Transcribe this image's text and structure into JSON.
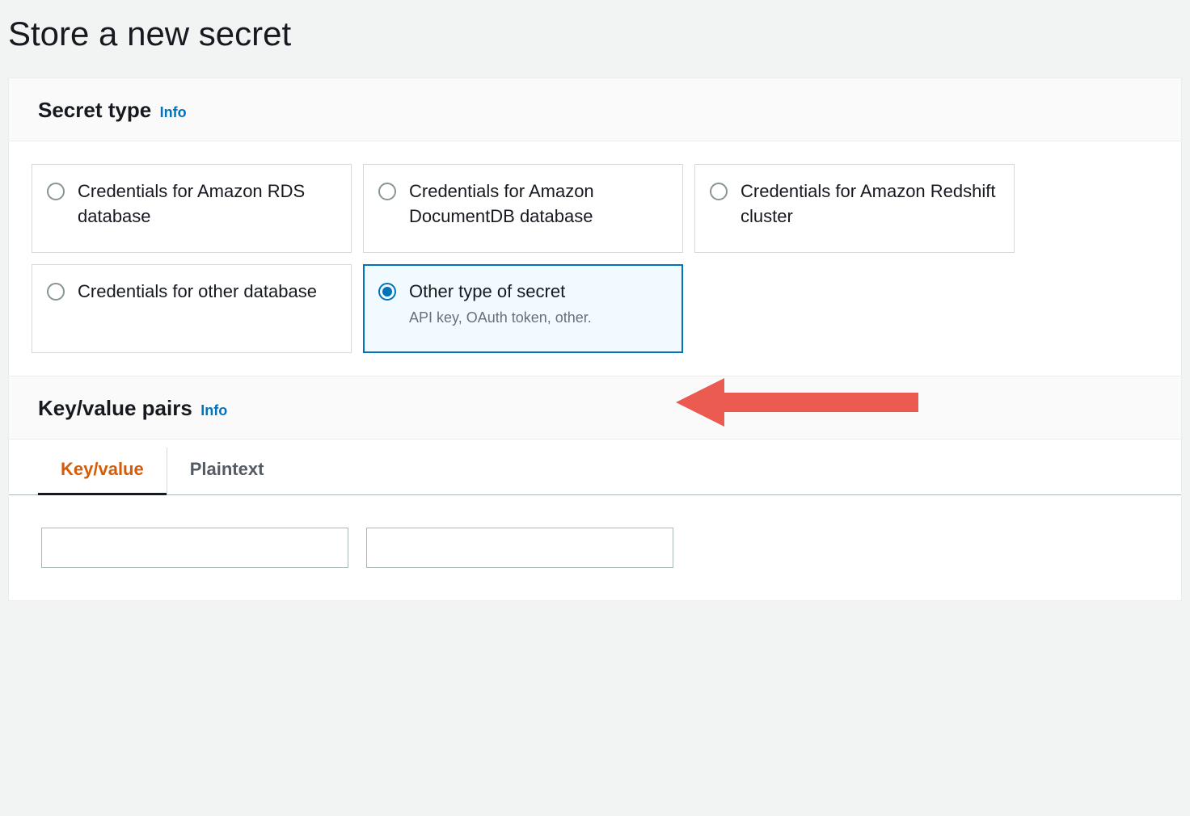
{
  "page": {
    "title": "Store a new secret"
  },
  "secretType": {
    "heading": "Secret type",
    "infoLabel": "Info",
    "options": [
      {
        "label": "Credentials for Amazon RDS database",
        "description": "",
        "selected": false
      },
      {
        "label": "Credentials for Amazon DocumentDB database",
        "description": "",
        "selected": false
      },
      {
        "label": "Credentials for Amazon Redshift cluster",
        "description": "",
        "selected": false
      },
      {
        "label": "Credentials for other database",
        "description": "",
        "selected": false
      },
      {
        "label": "Other type of secret",
        "description": "API key, OAuth token, other.",
        "selected": true
      }
    ]
  },
  "keyValue": {
    "heading": "Key/value pairs",
    "infoLabel": "Info",
    "tabs": [
      {
        "label": "Key/value",
        "active": true
      },
      {
        "label": "Plaintext",
        "active": false
      }
    ],
    "row": {
      "key": "",
      "value": ""
    }
  },
  "annotation": {
    "arrowColor": "#ec5b52"
  }
}
